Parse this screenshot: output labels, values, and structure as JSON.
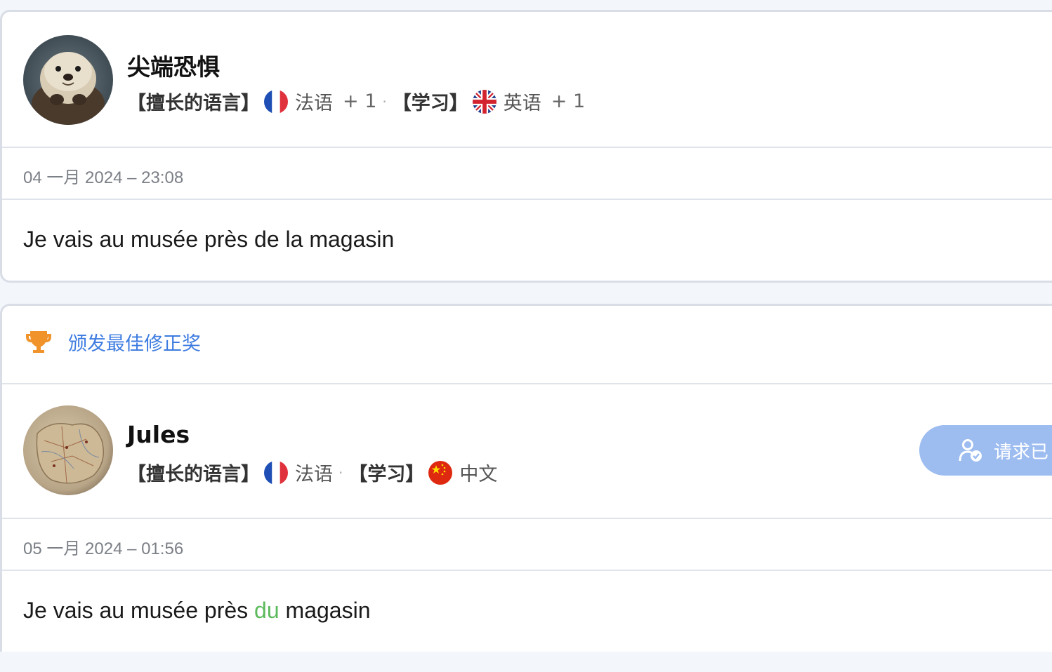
{
  "posts": [
    {
      "username": "尖端恐惧",
      "native_label": "【擅长的语言】",
      "native_lang": "法语",
      "native_more": "+ 1",
      "learning_label": "【学习】",
      "learning_lang": "英语",
      "learning_more": "+ 1",
      "date": "04 一月 2024 – 23:08",
      "sentence": "Je vais au musée près de la magasin"
    },
    {
      "award_text": "颁发最佳修正奖",
      "username": "Jules",
      "native_label": "【擅长的语言】",
      "native_lang": "法语",
      "learning_label": "【学习】",
      "learning_lang": "中文",
      "request_button": "请求已",
      "date": "05 一月 2024 – 01:56",
      "sentence_before": "Je vais au musée près ",
      "sentence_corrected": "du",
      "sentence_after": " magasin"
    }
  ],
  "icons": {
    "trophy": "trophy-icon",
    "flag_fr": "france-flag-icon",
    "flag_uk": "uk-flag-icon",
    "flag_cn": "china-flag-icon",
    "user_check": "user-check-icon"
  },
  "colors": {
    "accent_link": "#3d7be0",
    "correction_green": "#5cba5c",
    "button_bg": "#9dbcf0",
    "trophy": "#f0932b"
  }
}
